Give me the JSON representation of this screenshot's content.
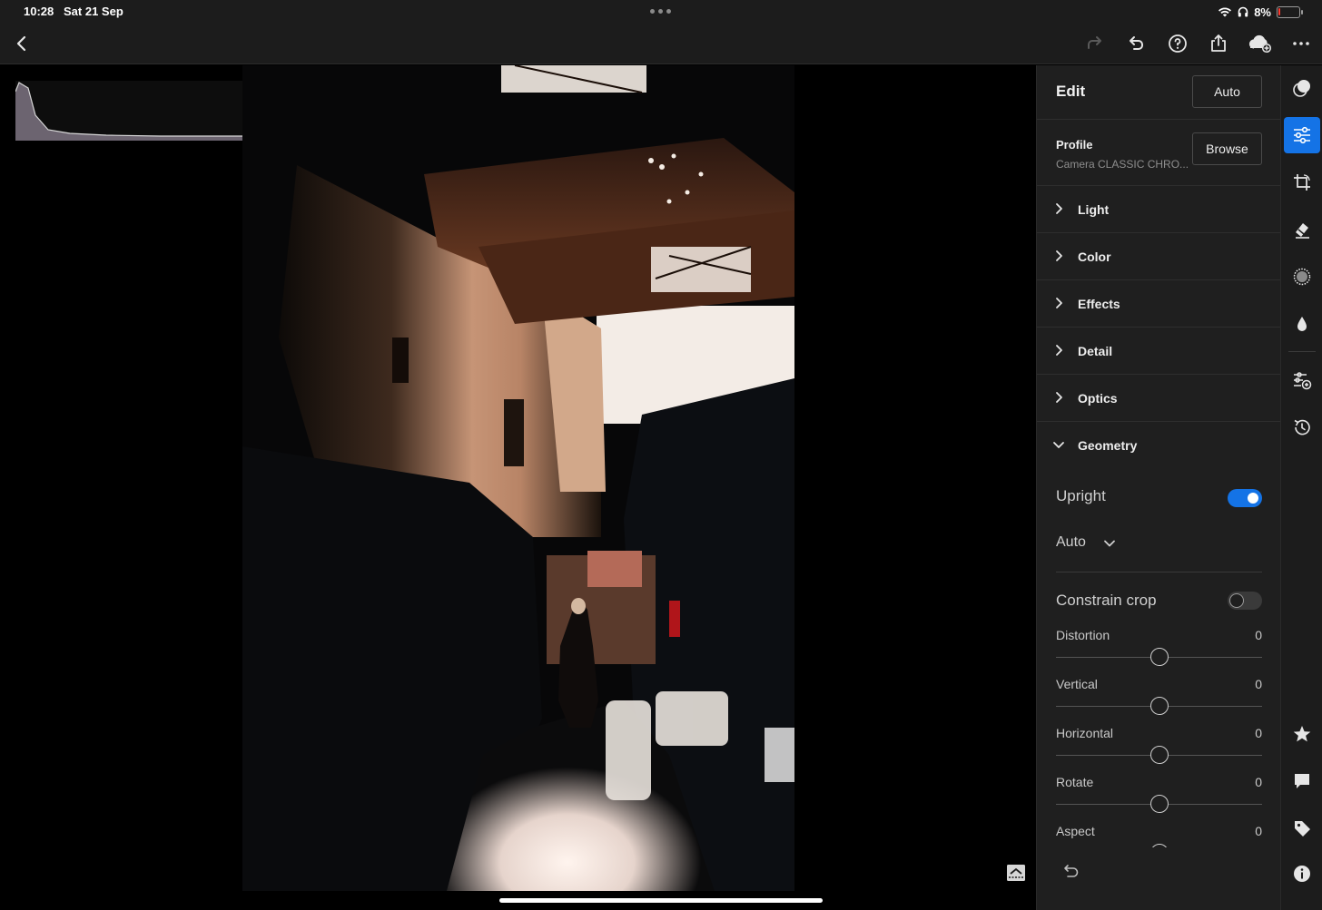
{
  "status_bar": {
    "time": "10:28",
    "date": "Sat 21 Sep",
    "battery_percent": "8%",
    "battery_level": 0.08,
    "icons": [
      "wifi-icon",
      "headphones-icon",
      "battery-icon"
    ]
  },
  "toolbar": {
    "buttons": [
      "back-icon",
      "redo-icon",
      "undo-icon",
      "help-icon",
      "share-icon",
      "cloud-sync-icon",
      "more-icon"
    ]
  },
  "edit_panel": {
    "title": "Edit",
    "auto_label": "Auto",
    "profile": {
      "label": "Profile",
      "value": "Camera CLASSIC CHRO...",
      "browse_label": "Browse"
    },
    "sections": [
      {
        "name": "Light",
        "expanded": false
      },
      {
        "name": "Color",
        "expanded": false
      },
      {
        "name": "Effects",
        "expanded": false
      },
      {
        "name": "Detail",
        "expanded": false
      },
      {
        "name": "Optics",
        "expanded": false
      },
      {
        "name": "Geometry",
        "expanded": true
      }
    ],
    "geometry": {
      "upright_label": "Upright",
      "upright_on": true,
      "upright_mode": "Auto",
      "constrain_crop_label": "Constrain crop",
      "constrain_crop_on": false,
      "sliders": [
        {
          "label": "Distortion",
          "value": "0"
        },
        {
          "label": "Vertical",
          "value": "0"
        },
        {
          "label": "Horizontal",
          "value": "0"
        },
        {
          "label": "Rotate",
          "value": "0"
        },
        {
          "label": "Aspect",
          "value": "0"
        }
      ]
    }
  },
  "rail": {
    "tools": [
      "presets-icon",
      "edit-sliders-icon",
      "crop-icon",
      "healing-icon",
      "masking-icon",
      "blur-icon",
      "versions-icon",
      "history-icon"
    ],
    "active_tool": "edit-sliders-icon",
    "bottom_tools": [
      "rating-icon",
      "comment-icon",
      "tag-icon",
      "info-icon"
    ]
  },
  "colors": {
    "accent": "#1473e6",
    "panel_bg": "#1f1f1f",
    "toolbar_bg": "#1c1c1c"
  }
}
